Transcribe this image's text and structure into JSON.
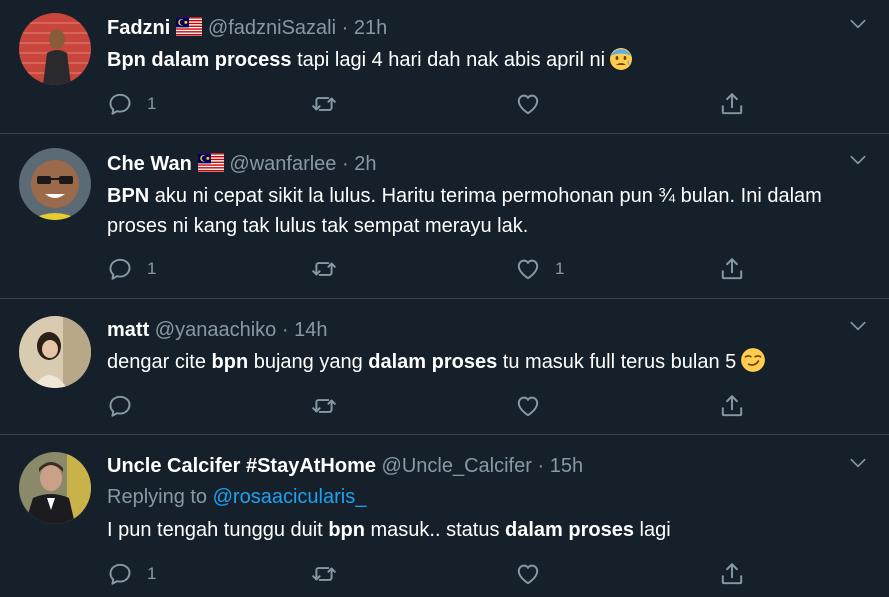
{
  "tweets": [
    {
      "name": "Fadzni",
      "handle": "@fadzniSazali",
      "time": "21h",
      "dot": "·",
      "body_bold1": "Bpn dalam process",
      "body_text1": " tapi lagi 4 hari dah nak abis april ni",
      "emoji": "anxious-face",
      "reply_count": "1",
      "retweet_count": "",
      "like_count": ""
    },
    {
      "name": "Che Wan",
      "handle": "@wanfarlee",
      "time": "2h",
      "dot": "·",
      "body_bold1": "BPN",
      "body_text1": " aku ni cepat sikit la lulus. Haritu terima permohonan pun ¾ bulan. Ini dalam proses ni kang tak lulus tak sempat merayu lak.",
      "reply_count": "1",
      "retweet_count": "",
      "like_count": "1"
    },
    {
      "name": "matt",
      "handle": "@yanaachiko",
      "time": "14h",
      "dot": "·",
      "body_text1": "dengar cite ",
      "body_bold1": "bpn",
      "body_text2": " bujang yang ",
      "body_bold2": "dalam proses",
      "body_text3": " tu masuk full terus bulan 5",
      "emoji": "smirking-face",
      "reply_count": "",
      "retweet_count": "",
      "like_count": ""
    },
    {
      "name": "Uncle Calcifer #StayAtHome",
      "handle": "@Uncle_Calcifer",
      "time": "15h",
      "dot": "·",
      "replying_prefix": "Replying to ",
      "replying_to": "@rosaacicularis_",
      "body_text1": "I pun tengah tunggu duit ",
      "body_bold1": "bpn",
      "body_text2": " masuk.. status ",
      "body_bold2": "dalam proses",
      "body_text3": " lagi",
      "reply_count": "1",
      "retweet_count": "",
      "like_count": ""
    }
  ],
  "colors": {
    "background": "#15202b",
    "divider": "#38444d",
    "secondary_text": "#8899a6",
    "link": "#1da1f2"
  },
  "icons": [
    "reply-icon",
    "retweet-icon",
    "like-icon",
    "share-icon",
    "chevron-down-icon",
    "malaysia-flag-icon"
  ]
}
